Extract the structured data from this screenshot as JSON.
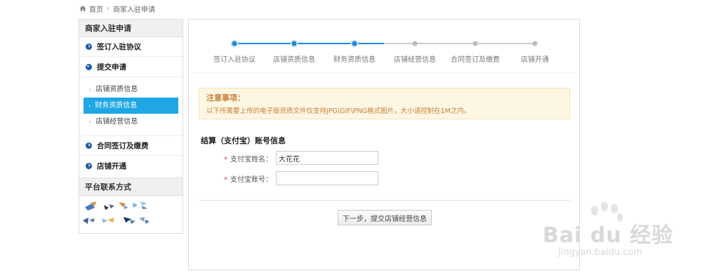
{
  "breadcrumb": {
    "home": "首页",
    "current": "商家入驻申请"
  },
  "sidebar": {
    "title": "商家入驻申请",
    "steps": [
      {
        "label": "签订入驻协议"
      },
      {
        "label": "提交申请"
      },
      {
        "label": "合同签订及缴费"
      },
      {
        "label": "店铺开通"
      }
    ],
    "sub_items": [
      {
        "label": "店铺资质信息"
      },
      {
        "label": "财务资质信息",
        "active": true
      },
      {
        "label": "店铺经营信息"
      }
    ],
    "contact_title": "平台联系方式"
  },
  "progress": {
    "current_index": 2,
    "steps": [
      {
        "label": "签订入驻协议",
        "done": true
      },
      {
        "label": "店铺资质信息",
        "done": true
      },
      {
        "label": "财务资质信息",
        "done": true
      },
      {
        "label": "店铺经营信息",
        "done": false
      },
      {
        "label": "合同签订及缴费",
        "done": false
      },
      {
        "label": "店铺开通",
        "done": false
      }
    ],
    "active_color": "#1e88d8",
    "inactive_color": "#bbbbbb"
  },
  "notice": {
    "title": "注意事项：",
    "body": "以下所需要上传的电子版资质文件仅支持JPG\\GIF\\PNG格式图片，大小请控制在1M之内。"
  },
  "form": {
    "section_title": "结算（支付宝）账号信息",
    "alipay_name_label": "支付宝姓名：",
    "alipay_name_value": "大花花",
    "alipay_account_label": "支付宝账号：",
    "alipay_account_value": "",
    "required_mark": "*"
  },
  "next_button": "下一步，提交店铺经营信息",
  "watermark": {
    "text": "Bai du 经验",
    "url": "jingyan.baidu.com"
  }
}
